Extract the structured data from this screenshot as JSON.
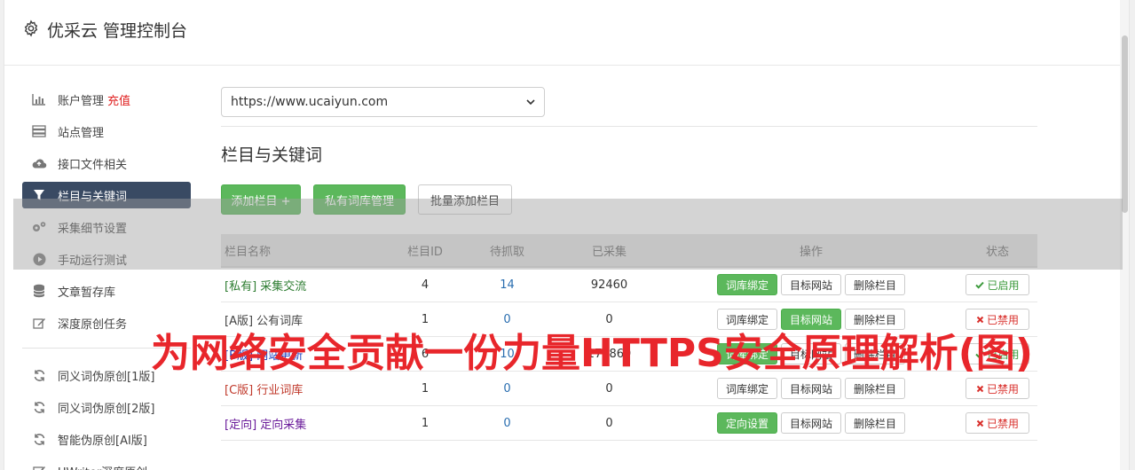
{
  "header": {
    "title": "优采云 管理控制台"
  },
  "sidebar": {
    "items": [
      {
        "label": "账户管理",
        "badge": "充值",
        "icon": "bar-chart-icon"
      },
      {
        "label": "站点管理",
        "icon": "server-icon"
      },
      {
        "label": "接口文件相关",
        "icon": "cloud-upload-icon"
      },
      {
        "label": "栏目与关键词",
        "icon": "filter-icon",
        "active": true
      },
      {
        "label": "采集细节设置",
        "icon": "cogs-icon"
      },
      {
        "label": "手动运行测试",
        "icon": "play-circle-icon"
      },
      {
        "label": "文章暂存库",
        "icon": "database-icon"
      },
      {
        "label": "深度原创任务",
        "icon": "edit-icon"
      }
    ],
    "items2": [
      {
        "label": "同义词伪原创[1版]",
        "icon": "refresh-icon"
      },
      {
        "label": "同义词伪原创[2版]",
        "icon": "refresh-icon"
      },
      {
        "label": "智能伪原创[AI版]",
        "icon": "refresh-icon"
      },
      {
        "label": "UWriter深度原创",
        "icon": "edit-icon"
      }
    ]
  },
  "main": {
    "site_select": "https://www.ucaiyun.com",
    "section_title": "栏目与关键词",
    "buttons": {
      "add_column": "添加栏目 +",
      "private_lib": "私有词库管理",
      "batch_add": "批量添加栏目"
    },
    "table": {
      "headers": {
        "name": "栏目名称",
        "id": "栏目ID",
        "wait": "待抓取",
        "done": "已采集",
        "ops": "操作",
        "status": "状态"
      },
      "rows": [
        {
          "name": "[私有] 采集交流",
          "name_color": "#2e7d32",
          "id": "4",
          "wait": "14",
          "done": "92460",
          "op1": "词库绑定",
          "op1_green": true,
          "op2": "目标网站",
          "op2_green": false,
          "op3": "删除栏目",
          "status": "已启用",
          "status_on": true
        },
        {
          "name": "[A版] 公有词库",
          "name_color": "#444444",
          "id": "1",
          "wait": "0",
          "done": "0",
          "op1": "词库绑定",
          "op1_green": false,
          "op2": "目标网站",
          "op2_green": true,
          "op3": "删除栏目",
          "status": "已禁用",
          "status_on": false
        },
        {
          "name": "[B版] 网站更新",
          "name_color": "#1a3fbf",
          "id": "6",
          "wait": "10",
          "done": "174869",
          "op1": "词库绑定",
          "op1_green": true,
          "op2": "目标网站",
          "op2_green": false,
          "op3": "删除栏目",
          "status": "已启用",
          "status_on": true
        },
        {
          "name": "[C版] 行业词库",
          "name_color": "#c0392b",
          "id": "1",
          "wait": "0",
          "done": "0",
          "op1": "词库绑定",
          "op1_green": false,
          "op2": "目标网站",
          "op2_green": false,
          "op3": "删除栏目",
          "status": "已禁用",
          "status_on": false
        },
        {
          "name": "[定向] 定向采集",
          "name_color": "#6a1b9a",
          "id": "1",
          "wait": "0",
          "done": "0",
          "op1": "定向设置",
          "op1_green": true,
          "op2": "目标网站",
          "op2_green": false,
          "op3": "删除栏目",
          "status": "已禁用",
          "status_on": false
        }
      ]
    }
  },
  "watermark": "为网络安全贡献一份力量HTTPS安全原理解析(图)",
  "colors": {
    "accent_green": "#5cb85c",
    "nav_active": "#394a63",
    "recharge": "#e02020",
    "watermark": "#e8262b"
  }
}
